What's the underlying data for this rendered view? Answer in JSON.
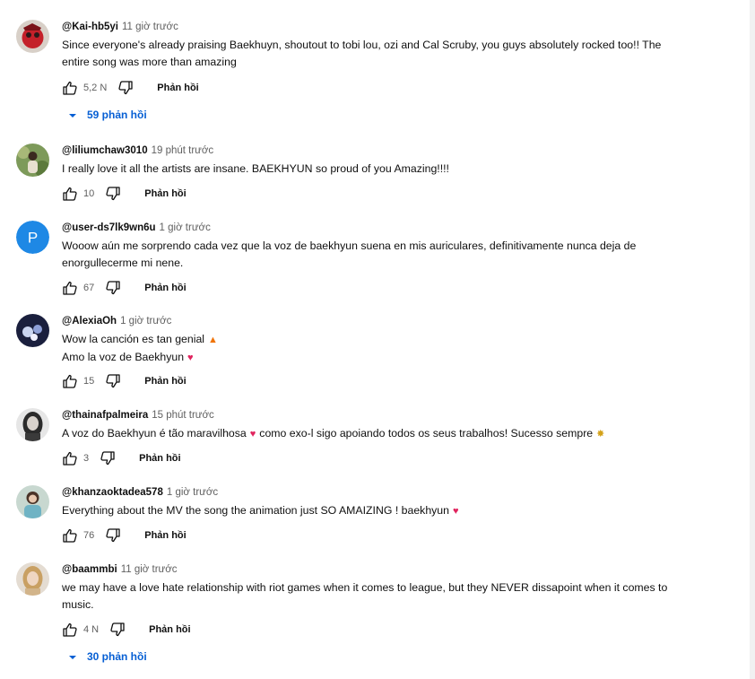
{
  "ui": {
    "reply_label": "Phản hồi"
  },
  "colors": {
    "link_blue": "#065fd4",
    "secondary_text": "#606060",
    "heart": "#e0245e"
  },
  "comments": [
    {
      "author": "@Kai-hb5yi",
      "time": "11 giờ trước",
      "text_lines": [
        "Since everyone's already praising Baekhuyn, shoutout to tobi lou, ozi and Cal Scruby, you guys absolutely rocked too!! The entire song was more than amazing"
      ],
      "likes": "5,2 N",
      "avatar_icon": "red-character-avatar",
      "replies": "59 phản hồi"
    },
    {
      "author": "@liliumchaw3010",
      "time": "19 phút trước",
      "text_lines": [
        "I really love it all the artists are insane. BAEKHYUN so proud of you Amazing!!!!"
      ],
      "likes": "10",
      "avatar_icon": "photo-avatar-green"
    },
    {
      "author": "@user-ds7lk9wn6u",
      "time": "1 giờ trước",
      "text_lines": [
        "Wooow aún me sorprendo cada vez que la voz de baekhyun suena en mis auriculares, definitivamente nunca deja de enorgullecerme mi nene."
      ],
      "likes": "67",
      "avatar_icon": "letter-p-avatar",
      "avatar_letter": "P"
    },
    {
      "author": "@AlexiaOh",
      "time": "1 giờ trước",
      "text_lines": [
        "Wow la canción es tan genial",
        "Amo la voz de Baekhyun"
      ],
      "emojis": [
        "fire-emoji",
        "heart-emoji"
      ],
      "likes": "15",
      "avatar_icon": "dark-photo-avatar"
    },
    {
      "author": "@thainafpalmeira",
      "time": "15 phút trước",
      "text_parts": [
        "A voz do Baekhyun é tão maravilhosa",
        "como exo-l sigo apoiando todos os seus trabalhos! Sucesso sempre"
      ],
      "emojis": [
        "heart-emoji",
        "party-popper-emoji"
      ],
      "likes": "3",
      "avatar_icon": "bw-photo-avatar"
    },
    {
      "author": "@khanzaoktadea578",
      "time": "1 giờ trước",
      "text_lines": [
        "Everything about the MV the song the animation just SO AMAIZING ! baekhyun"
      ],
      "emojis": [
        "heart-emoji"
      ],
      "likes": "76",
      "avatar_icon": "photo-avatar-light"
    },
    {
      "author": "@baammbi",
      "time": "11 giờ trước",
      "text_lines": [
        "we may have a love hate relationship with riot games when it comes to league, but they NEVER dissapoint when it comes to music."
      ],
      "likes": "4 N",
      "avatar_icon": "photo-avatar-blonde",
      "replies": "30 phản hồi"
    }
  ]
}
